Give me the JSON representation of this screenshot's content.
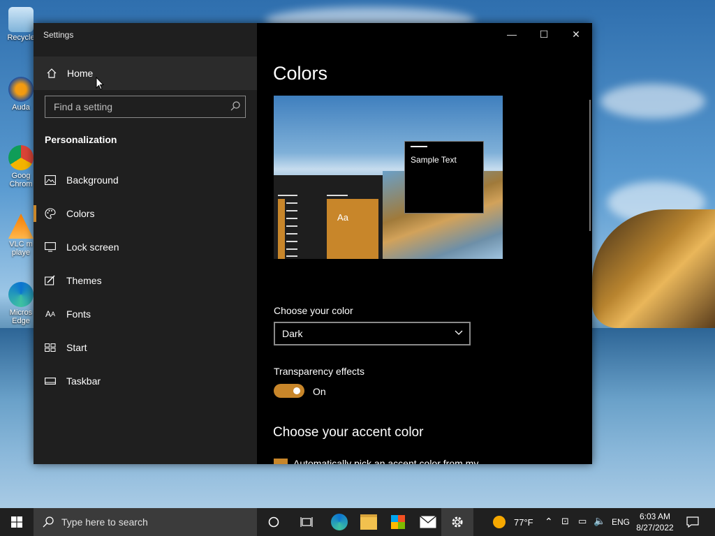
{
  "desktop": {
    "icons": [
      {
        "label": "Recycle"
      },
      {
        "label": "Auda"
      },
      {
        "label": "Goog Chrom"
      },
      {
        "label": "VLC m playe"
      },
      {
        "label": "Micros Edge"
      }
    ]
  },
  "window": {
    "title": "Settings",
    "controls": {
      "minimize": "—",
      "maximize": "☐",
      "close": "✕"
    }
  },
  "sidebar": {
    "home_label": "Home",
    "search_placeholder": "Find a setting",
    "section_title": "Personalization",
    "items": [
      {
        "label": "Background"
      },
      {
        "label": "Colors"
      },
      {
        "label": "Lock screen"
      },
      {
        "label": "Themes"
      },
      {
        "label": "Fonts"
      },
      {
        "label": "Start"
      },
      {
        "label": "Taskbar"
      }
    ]
  },
  "content": {
    "title": "Colors",
    "preview": {
      "tile_text": "Aa",
      "sample_text": "Sample Text"
    },
    "choose_color_label": "Choose your color",
    "choose_color_value": "Dark",
    "transparency_label": "Transparency effects",
    "transparency_state": "On",
    "accent_title": "Choose your accent color",
    "accent_auto_text": "Automatically pick an accent color from my background",
    "accent_color": "#c8862a"
  },
  "taskbar": {
    "search_placeholder": "Type here to search",
    "weather": "77°F",
    "language": "ENG",
    "time": "6:03 AM",
    "date": "8/27/2022"
  }
}
